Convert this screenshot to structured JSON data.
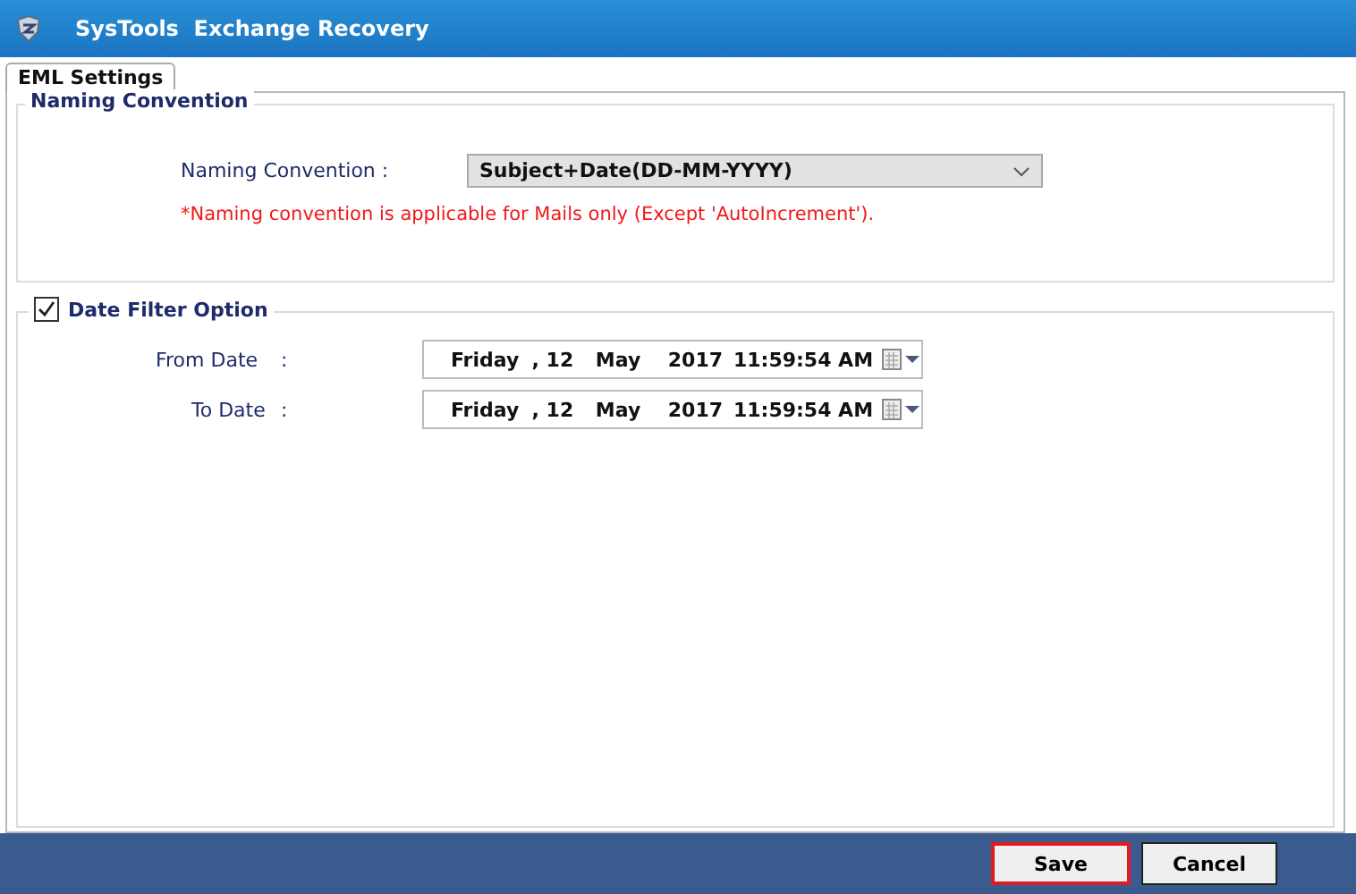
{
  "window": {
    "title": "SysTools  Exchange Recovery"
  },
  "tabs": [
    {
      "label": "EML Settings",
      "selected": true
    }
  ],
  "naming": {
    "legend": "Naming Convention",
    "label": "Naming Convention :",
    "value": "Subject+Date(DD-MM-YYYY)",
    "note": "*Naming convention is applicable for Mails only (Except 'AutoIncrement')."
  },
  "date_filter": {
    "legend": "Date Filter Option",
    "checked": true,
    "rows": [
      {
        "label": "From Date",
        "colon": ":",
        "parts": [
          "Friday",
          ", 12",
          "May",
          "2017",
          "11:59:54 AM"
        ]
      },
      {
        "label": "To Date",
        "colon": ":",
        "parts": [
          "Friday",
          ", 12",
          "May",
          "2017",
          "11:59:54 AM"
        ]
      }
    ]
  },
  "buttons": [
    {
      "label": "Save",
      "focused": true
    },
    {
      "label": "Cancel",
      "focused": false
    }
  ]
}
